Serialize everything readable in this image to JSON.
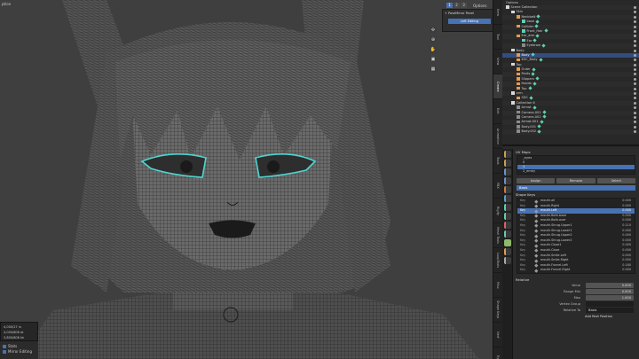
{
  "viewport": {
    "header_left": "ption",
    "toolbar_buttons": [
      "1",
      "2",
      "3"
    ],
    "options_label": "Options",
    "tool_panel": {
      "title": "+ PoseMirror Panel",
      "button": "Left Editing"
    },
    "nav_icons": [
      "gizmo-icon",
      "zoom-icon",
      "hand-icon",
      "camera-icon",
      "grid-icon"
    ],
    "stats": [
      "4,000/27 in",
      "4,000/808 ot",
      "3,800/808 kk"
    ],
    "status_label": "Stats",
    "mirror_label": "Mirror Editing"
  },
  "sidebar_tabs": [
    "Item",
    "Tool",
    "View",
    "Create",
    "Edit",
    "Animation",
    "Tools",
    "FBX",
    "Rigify",
    "Mesh Tools",
    "LoopTools",
    "Misc",
    "Shape Keys",
    "Nerf",
    "Eyes"
  ],
  "outliner": {
    "options": "Options",
    "rows": [
      {
        "label": "Scene Collection",
        "indent": 0,
        "sel": false,
        "color": "#d8d8d8"
      },
      {
        "label": "Skin",
        "indent": 1,
        "sel": false,
        "color": "#d8d8d8"
      },
      {
        "label": "Neckbelt",
        "indent": 2,
        "sel": false,
        "color": "#e59a4c"
      },
      {
        "label": "base",
        "indent": 3,
        "sel": false,
        "color": "#5fcfb0"
      },
      {
        "label": "Collider",
        "indent": 2,
        "sel": false,
        "color": "#e59a4c"
      },
      {
        "label": "Front_Hair",
        "indent": 3,
        "sel": false,
        "color": "#5fcfb0"
      },
      {
        "label": "Ear_arm",
        "indent": 2,
        "sel": false,
        "color": "#e59a4c"
      },
      {
        "label": "Ear",
        "indent": 3,
        "sel": false,
        "color": "#5fcfb0"
      },
      {
        "label": "Eyebrow",
        "indent": 3,
        "sel": false,
        "color": "#8a8a8a"
      },
      {
        "label": "Body",
        "indent": 1,
        "sel": false,
        "color": "#d8d8d8"
      },
      {
        "label": "Body",
        "indent": 2,
        "sel": true,
        "color": "#e59a4c"
      },
      {
        "label": "KSC_Body",
        "indent": 2,
        "sel": false,
        "color": "#e59a4c"
      },
      {
        "label": "Top",
        "indent": 1,
        "sel": false,
        "color": "#d8d8d8"
      },
      {
        "label": "Outer",
        "indent": 2,
        "sel": false,
        "color": "#e59a4c"
      },
      {
        "label": "Pants",
        "indent": 2,
        "sel": false,
        "color": "#e59a4c"
      },
      {
        "label": "Slippers",
        "indent": 2,
        "sel": false,
        "color": "#e59a4c"
      },
      {
        "label": "Hoods",
        "indent": 2,
        "sel": false,
        "color": "#e59a4c"
      },
      {
        "label": "Top",
        "indent": 2,
        "sel": false,
        "color": "#e59a4c"
      },
      {
        "label": "arm",
        "indent": 1,
        "sel": false,
        "color": "#d8d8d8"
      },
      {
        "label": "SDC",
        "indent": 2,
        "sel": false,
        "color": "#e59a4c"
      },
      {
        "label": "Collection 6",
        "indent": 1,
        "sel": false,
        "color": "#d8d8d8"
      },
      {
        "label": "Armat",
        "indent": 2,
        "sel": false,
        "color": "#8a8a8a"
      },
      {
        "label": "Camera.001",
        "indent": 2,
        "sel": false,
        "color": "#8a8a8a"
      },
      {
        "label": "Camera.002",
        "indent": 2,
        "sel": false,
        "color": "#8a8a8a"
      },
      {
        "label": "Armat.001",
        "indent": 2,
        "sel": false,
        "color": "#8a8a8a"
      },
      {
        "label": "Body.001",
        "indent": 2,
        "sel": false,
        "color": "#8a8a8a"
      },
      {
        "label": "Body.002",
        "indent": 2,
        "sel": false,
        "color": "#8a8a8a"
      }
    ]
  },
  "props": {
    "uv_header": "UV Maps",
    "uv_maps": [
      {
        "label": "_eyes",
        "sel": false
      },
      {
        "label": "0",
        "sel": false
      },
      {
        "label": "1",
        "sel": true
      },
      {
        "label": "2_emey",
        "sel": false
      }
    ],
    "buttons": [
      "Assign",
      "Remove",
      "Select"
    ],
    "active_field": "Basis",
    "shape_header": "Shape Keys",
    "shape_keys": [
      {
        "key": "Key",
        "name": "mouth.all",
        "value": "0.000",
        "sel": false
      },
      {
        "key": "Key",
        "name": "mouth.Right",
        "value": "0.000",
        "sel": false
      },
      {
        "key": "Key",
        "name": "mouth.Left",
        "value": "0.000",
        "sel": true
      },
      {
        "key": "Key",
        "name": "mouth.Both.base",
        "value": "0.000",
        "sel": false
      },
      {
        "key": "Key",
        "name": "mouth.Both.over",
        "value": "0.000",
        "sel": false
      },
      {
        "key": "Key",
        "name": "mouth.Shrug.Upper1",
        "value": "0.110",
        "sel": false
      },
      {
        "key": "Key",
        "name": "mouth.Shrug.Lower1",
        "value": "0.000",
        "sel": false
      },
      {
        "key": "Key",
        "name": "mouth.Shrug.Upper2",
        "value": "0.000",
        "sel": false
      },
      {
        "key": "Key",
        "name": "mouth.Shrug.Lower2",
        "value": "0.000",
        "sel": false
      },
      {
        "key": "Key",
        "name": "mouth.Close1",
        "value": "0.000",
        "sel": false
      },
      {
        "key": "Key",
        "name": "mouth.Close",
        "value": "0.000",
        "sel": false
      },
      {
        "key": "Key",
        "name": "mouth.Smile.Left",
        "value": "0.000",
        "sel": false
      },
      {
        "key": "Key",
        "name": "mouth.Smile.Right",
        "value": "0.000",
        "sel": false
      },
      {
        "key": "Key",
        "name": "mouth.Funnel.Left",
        "value": "0.180",
        "sel": false
      },
      {
        "key": "Key",
        "name": "mouth.Funnel.Right",
        "value": "0.000",
        "sel": false
      }
    ],
    "relative": "Relative",
    "fields": [
      {
        "label": "Value",
        "value": "0.000",
        "dark": false
      },
      {
        "label": "Range Min",
        "value": "0.000",
        "dark": false
      },
      {
        "label": "Max",
        "value": "1.000",
        "dark": false
      },
      {
        "label": "Vertex Group",
        "value": "",
        "dark": true
      },
      {
        "label": "Relative To",
        "value": "Basis",
        "dark": true
      }
    ],
    "add_rest": "Add Rest Position"
  },
  "colors": {
    "accent": "#4772b3",
    "wire": "#000000",
    "eye_wire": "#4fd6d0"
  }
}
